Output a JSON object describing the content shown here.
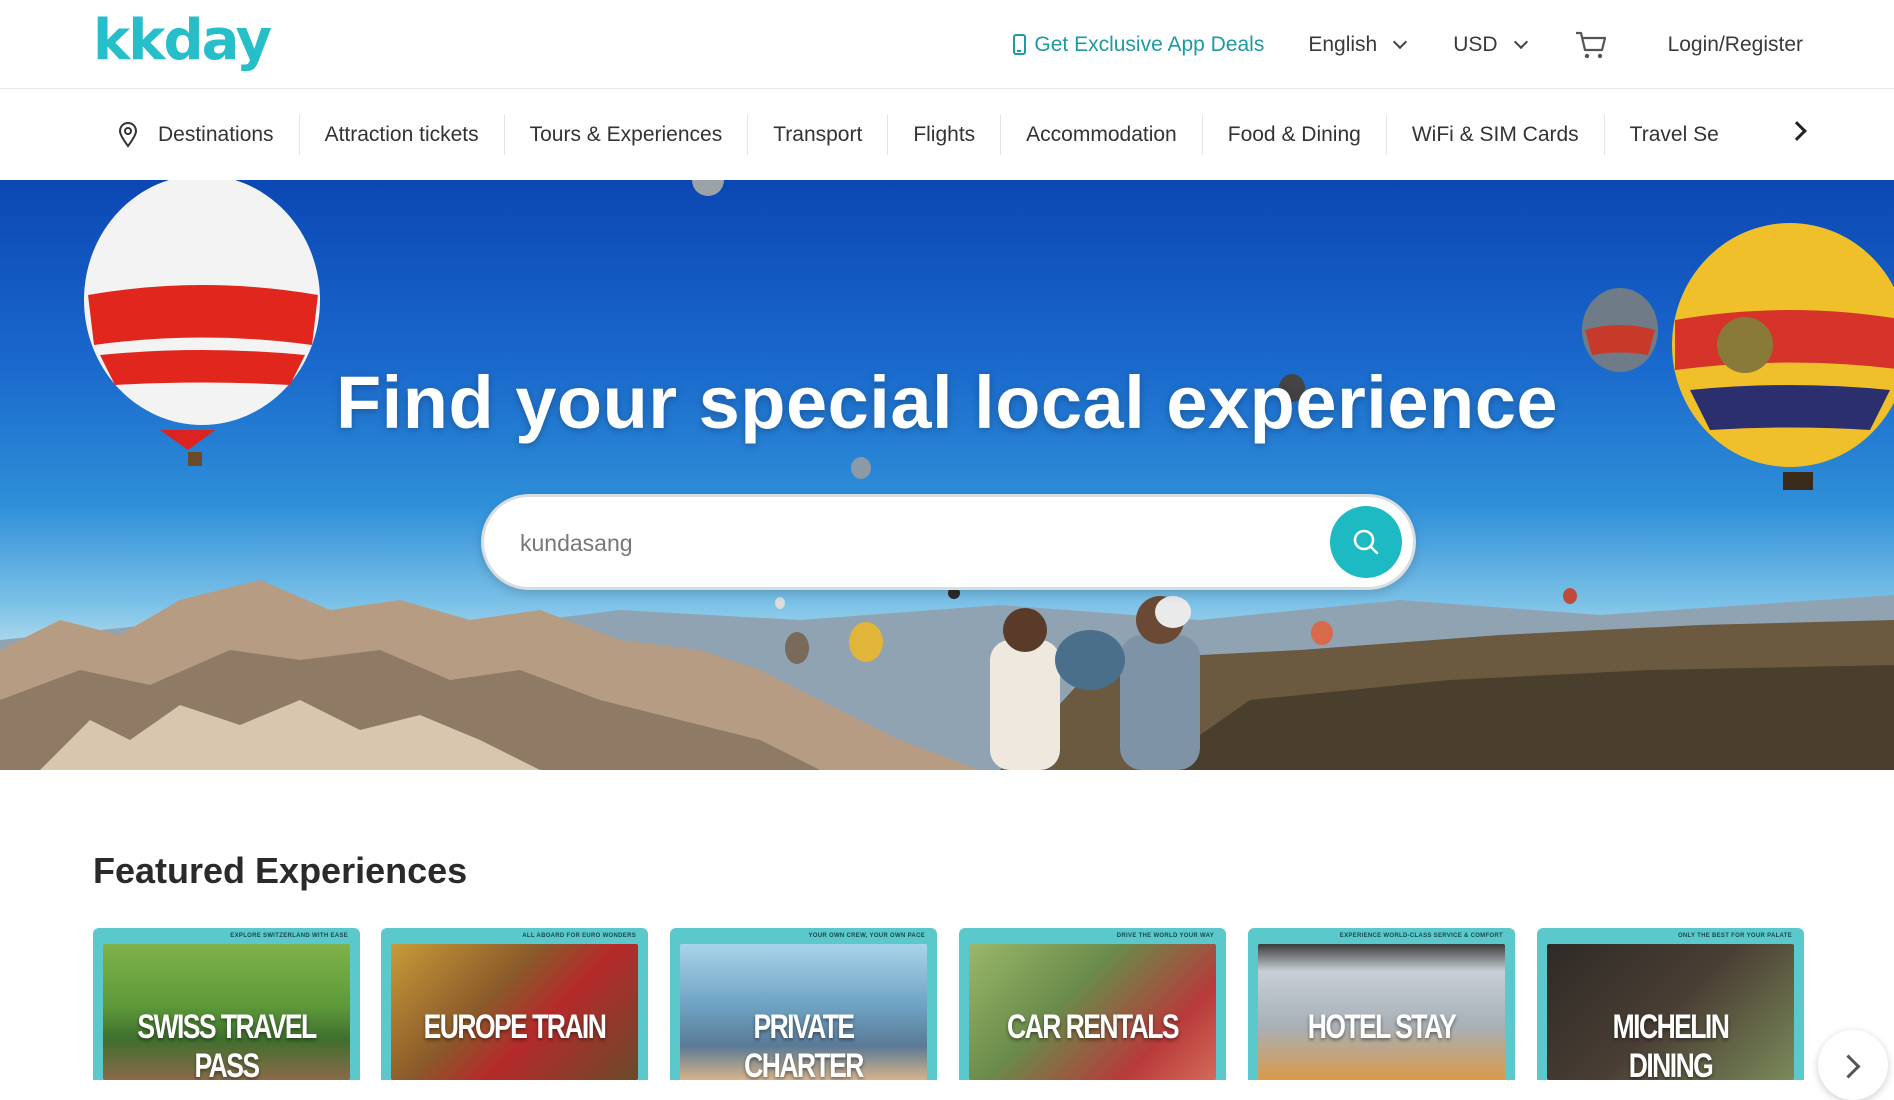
{
  "header": {
    "logo_text": "kkday",
    "app_deals_label": "Get Exclusive App Deals",
    "language": "English",
    "currency": "USD",
    "login_label": "Login/Register",
    "brand_color": "#26bec9"
  },
  "categories": [
    {
      "label": "Destinations"
    },
    {
      "label": "Attraction tickets"
    },
    {
      "label": "Tours & Experiences"
    },
    {
      "label": "Transport"
    },
    {
      "label": "Flights"
    },
    {
      "label": "Accommodation"
    },
    {
      "label": "Food & Dining"
    },
    {
      "label": "WiFi & SIM Cards"
    },
    {
      "label": "Travel Se"
    }
  ],
  "hero": {
    "title": "Find your special local experience",
    "search_value": "kundasang",
    "search_button_icon": "search-icon"
  },
  "featured": {
    "title": "Featured Experiences",
    "cards": [
      {
        "title": "SWISS TRAVEL PASS",
        "tag": "EXPLORE SWITZERLAND WITH EASE"
      },
      {
        "title": "EUROPE TRAIN",
        "tag": "ALL ABOARD FOR EURO WONDERS"
      },
      {
        "title": "PRIVATE CHARTER",
        "tag": "YOUR OWN CREW, YOUR OWN PACE"
      },
      {
        "title": "CAR RENTALS",
        "tag": "DRIVE THE WORLD YOUR WAY"
      },
      {
        "title": "HOTEL STAY",
        "tag": "EXPERIENCE WORLD-CLASS SERVICE & COMFORT"
      },
      {
        "title": "MICHELIN DINING",
        "tag": "ONLY THE BEST FOR YOUR PALATE"
      }
    ]
  }
}
